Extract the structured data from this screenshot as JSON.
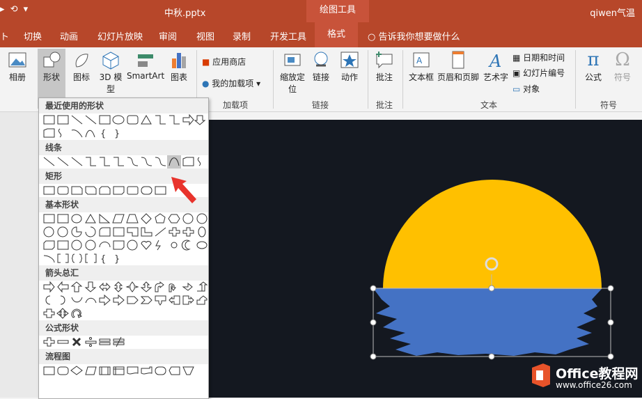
{
  "titlebar": {
    "qat": "▸ ⟲ ▾",
    "document": "中秋.pptx",
    "context_tab": "绘图工具",
    "user": "qiwen气温"
  },
  "tabs": [
    "切换",
    "动画",
    "幻灯片放映",
    "审阅",
    "视图",
    "录制",
    "开发工具",
    "格式"
  ],
  "tellme": "告诉我你想要做什么",
  "ribbon": {
    "album": "相册",
    "shapes": "形状",
    "icons": "图标",
    "model3d": "3D 模型",
    "smartart": "SmartArt",
    "chart": "图表",
    "store": "应用商店",
    "myaddins": "我的加载项",
    "addins_group": "加载项",
    "zoom": "缩放定位",
    "link": "链接",
    "action": "动作",
    "links_group": "链接",
    "comment": "批注",
    "comment_group": "批注",
    "textbox": "文本框",
    "headerfooter": "页眉和页脚",
    "wordart": "艺术字",
    "datetime": "日期和时间",
    "slidenum": "幻灯片编号",
    "object": "对象",
    "text_group": "文本",
    "equation": "公式",
    "symbol": "符号",
    "symbols_group": "符号"
  },
  "shapes_panel": {
    "recent": "最近使用的形状",
    "lines": "线条",
    "rectangles": "矩形",
    "basic": "基本形状",
    "arrows": "箭头总汇",
    "equation": "公式形状",
    "flowchart": "流程图"
  },
  "watermark": {
    "brand": "Office教程网",
    "url": "www.office26.com"
  },
  "colors": {
    "accent": "#b7472a",
    "sun": "#ffc000",
    "water": "#4472c4",
    "slide_bg": "#141820"
  }
}
